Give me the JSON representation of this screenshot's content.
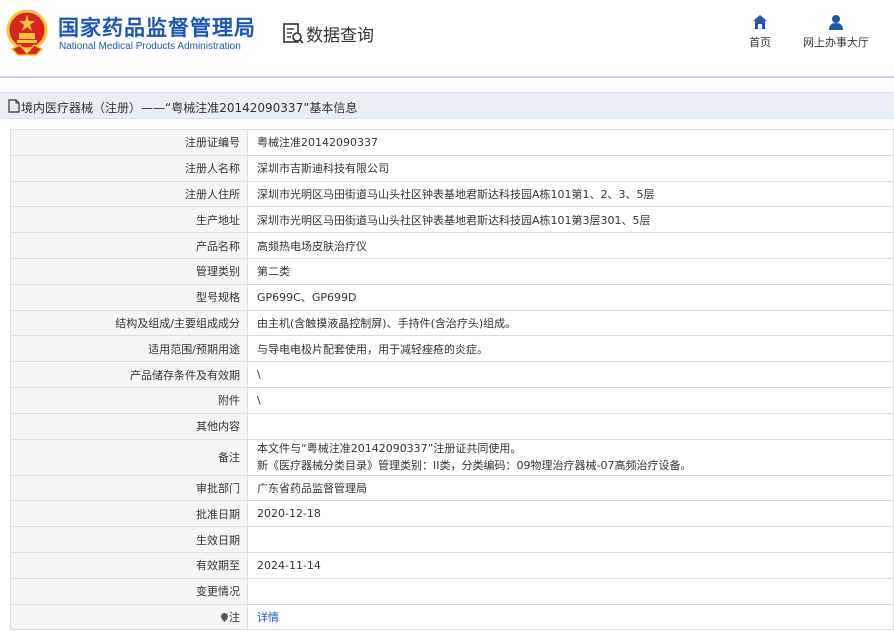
{
  "header": {
    "brand_cn": "国家药品监督管理局",
    "brand_en": "National Medical Products Administration",
    "query_title": "数据查询",
    "nav": [
      {
        "label": "首页",
        "icon": "home-icon"
      },
      {
        "label": "网上办事大厅",
        "icon": "user-icon"
      }
    ]
  },
  "breadcrumb": {
    "text": "境内医疗器械（注册）——“粤械注准20142090337”基本信息"
  },
  "table": {
    "rows": [
      {
        "key": "注册证编号",
        "value": "粤械注准20142090337"
      },
      {
        "key": "注册人名称",
        "value": "深圳市吉斯迪科技有限公司"
      },
      {
        "key": "注册人住所",
        "value": "深圳市光明区马田街道马山头社区钟表基地君斯达科技园A栋101第1、2、3、5层"
      },
      {
        "key": "生产地址",
        "value": "深圳市光明区马田街道马山头社区钟表基地君斯达科技园A栋101第3层301、5层"
      },
      {
        "key": "产品名称",
        "value": "高频热电场皮肤治疗仪"
      },
      {
        "key": "管理类别",
        "value": "第二类"
      },
      {
        "key": "型号规格",
        "value": "GP699C、GP699D"
      },
      {
        "key": "结构及组成/主要组成成分",
        "value": "由主机(含触摸液晶控制屏)、手持件(含治疗头)组成。"
      },
      {
        "key": "适用范围/预期用途",
        "value": "与导电电极片配套使用，用于减轻痤疮的炎症。"
      },
      {
        "key": "产品储存条件及有效期",
        "value": "\\"
      },
      {
        "key": "附件",
        "value": "\\"
      },
      {
        "key": "其他内容",
        "value": ""
      },
      {
        "key": "备注",
        "value_line1": "本文件与“粤械注准20142090337”注册证共同使用。",
        "value_line2": "新《医疗器械分类目录》管理类别：II类，分类编码：09物理治疗器械-07高频治疗设备。"
      },
      {
        "key": "审批部门",
        "value": "广东省药品监督管理局"
      },
      {
        "key": "批准日期",
        "value": "2020-12-18"
      },
      {
        "key": "生效日期",
        "value": ""
      },
      {
        "key": "有效期至",
        "value": "2024-11-14"
      },
      {
        "key": "变更情况",
        "value": ""
      },
      {
        "key": "注",
        "value": "详情"
      }
    ]
  },
  "colors": {
    "brand_blue": "#1c57b6",
    "emblem_red": "#d6261d",
    "emblem_gold": "#f3c53a"
  }
}
